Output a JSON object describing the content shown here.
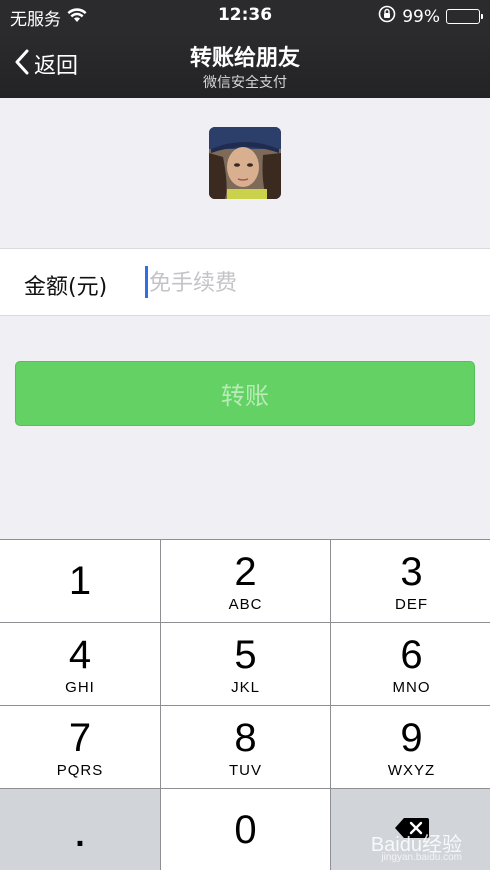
{
  "status": {
    "carrier": "无服务",
    "time": "12:36",
    "battery": "99%",
    "battery_level": 0.99
  },
  "nav": {
    "back_label": "返回",
    "title": "转账给朋友",
    "subtitle": "微信安全支付"
  },
  "amount": {
    "label": "金额(元)",
    "placeholder": "免手续费",
    "value": ""
  },
  "transfer_button": "转账",
  "keypad": {
    "keys": [
      {
        "num": "1",
        "letters": ""
      },
      {
        "num": "2",
        "letters": "ABC"
      },
      {
        "num": "3",
        "letters": "DEF"
      },
      {
        "num": "4",
        "letters": "GHI"
      },
      {
        "num": "5",
        "letters": "JKL"
      },
      {
        "num": "6",
        "letters": "MNO"
      },
      {
        "num": "7",
        "letters": "PQRS"
      },
      {
        "num": "8",
        "letters": "TUV"
      },
      {
        "num": "9",
        "letters": "WXYZ"
      },
      {
        "num": ".",
        "letters": ""
      },
      {
        "num": "0",
        "letters": ""
      }
    ]
  },
  "watermark": {
    "text": "Baidu经验",
    "url": "jingyan.baidu.com"
  },
  "colors": {
    "navbar": "#2b2b2d",
    "button_green": "#63d163",
    "caret": "#2f6fe6",
    "background": "#efeff4"
  }
}
